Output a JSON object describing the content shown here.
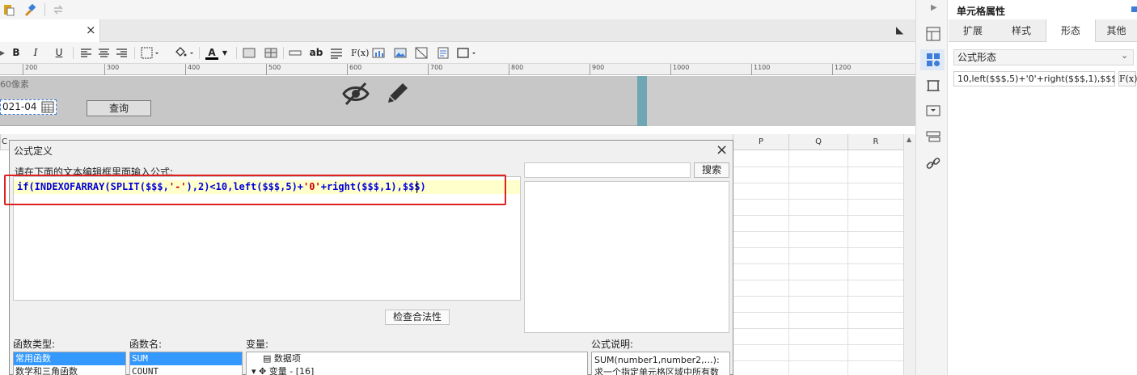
{
  "ruler": {
    "ticks": [
      "200",
      "300",
      "400",
      "500",
      "600",
      "700",
      "800",
      "900",
      "1000",
      "1100",
      "1200"
    ]
  },
  "toolbar": {
    "bold": "B",
    "italic": "I",
    "underline": "U",
    "font_color": "A",
    "border_text": "ab",
    "fx": "F(x)"
  },
  "param_panel": {
    "pixel_label": "60像素",
    "date_value": "021-04",
    "query_label": "查询"
  },
  "grid": {
    "left_col": "C",
    "columns": [
      "P",
      "Q",
      "R"
    ]
  },
  "dialog": {
    "title": "公式定义",
    "prompt": "请在下面的文本编辑框里面输入公式:",
    "formula": {
      "p1": "if(INDEXOFARRAY(SPLIT($$$,",
      "s1": "'-'",
      "p2": "),2)<10,left($$$,5)+",
      "s2": "'0'",
      "p3": "+right($$$,1),$$$)"
    },
    "search_label": "搜索",
    "check_label": "检查合法性",
    "func_type_label": "函数类型:",
    "func_name_label": "函数名:",
    "var_label": "变量:",
    "desc_label": "公式说明:",
    "func_types": [
      "常用函数",
      "数学和三角函数"
    ],
    "func_names": [
      "SUM",
      "COUNT"
    ],
    "variables": [
      "数据项",
      "变量 - [16]"
    ],
    "description": "SUM(number1,number2,…):求一个指定单元格区域中所有数"
  },
  "properties": {
    "title": "单元格属性",
    "tabs": [
      "扩展",
      "样式",
      "形态",
      "其他"
    ],
    "active_tab": "形态",
    "shape_value": "公式形态",
    "formula_value": "10,left($$$,5)+'0'+right($$$,1),$$$)",
    "fx_label": "F(x)"
  }
}
